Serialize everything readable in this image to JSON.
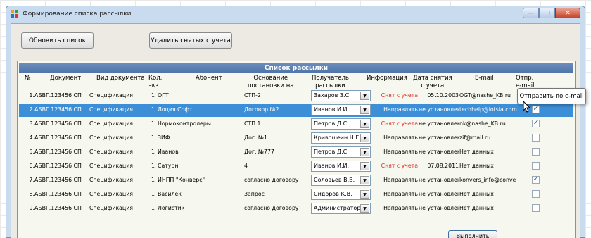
{
  "window": {
    "title": "Формирование списка рассылки",
    "min_icon": "minimize-icon",
    "max_icon": "maximize-icon",
    "close_icon": "close-icon"
  },
  "toolbar": {
    "refresh_label": "Обновить список",
    "delete_label": "Удалить снятых с учета"
  },
  "list": {
    "title": "Список рассылки",
    "columns": {
      "num": "№",
      "doc": "Документ",
      "type": "Вид документа",
      "qty1": "Кол.",
      "qty2": "экз",
      "abonent": "Абонент",
      "reason1": "Основание",
      "reason2": "постановки на",
      "recipient1": "Получатель",
      "recipient2": "рассылки",
      "info": "Информация",
      "date1": "Дата снятия",
      "date2": "с учета",
      "email": "E-mail",
      "send1": "Отпр.",
      "send2": "e-mail"
    },
    "rows": [
      {
        "num": "1.",
        "doc": "АБВГ.123456 СП",
        "type": "Спецификация",
        "qty": "1",
        "abonent": "ОГТ",
        "reason": "СТП-2",
        "recipient": "Захаров З.С.",
        "info": "Снят с учета",
        "info_red": true,
        "date": "05.10.2003",
        "email": "OGT@nashe_KB.ru",
        "checked": false
      },
      {
        "num": "2.",
        "doc": "АБВГ.123456 СП",
        "type": "Спецификация",
        "qty": "1",
        "abonent": "Лоция Софт",
        "reason": "Договор №2",
        "recipient": "Иванов И.И.",
        "info": "Направлять",
        "info_red": false,
        "date": "не установлена",
        "email": "techhelp@lotsia.com",
        "checked": true
      },
      {
        "num": "3.",
        "doc": "АБВГ.123456 СП",
        "type": "Спецификация",
        "qty": "1",
        "abonent": "Нормоконтролеры",
        "reason": "СТП 1",
        "recipient": "Петров Д.С.",
        "info": "Снят с учета",
        "info_red": true,
        "date": "не установлена",
        "email": "nk@nashe_KB.ru",
        "checked": true
      },
      {
        "num": "4.",
        "doc": "АБВГ.123456 СП",
        "type": "Спецификация",
        "qty": "1",
        "abonent": "ЗИФ",
        "reason": "Дог. №1",
        "recipient": "Кривошеин Н.Г.",
        "info": "Направлять",
        "info_red": false,
        "date": "не установлена",
        "email": "zif@mail.ru",
        "checked": false
      },
      {
        "num": "5.",
        "doc": "АБВГ.123456 СП",
        "type": "Спецификация",
        "qty": "1",
        "abonent": "Иванов",
        "reason": "Дог. №777",
        "recipient": "Петров Д.С.",
        "info": "Направлять",
        "info_red": false,
        "date": "не установлена",
        "email": "Нет данных",
        "checked": false
      },
      {
        "num": "6.",
        "doc": "АБВГ.123456 СП",
        "type": "Спецификация",
        "qty": "1",
        "abonent": "Сатурн",
        "reason": "4",
        "recipient": "Иванов И.И.",
        "info": "Снят с учета",
        "info_red": true,
        "date": "07.08.2011",
        "email": "Нет данных",
        "checked": false
      },
      {
        "num": "7.",
        "doc": "АБВГ.123456 СП",
        "type": "Спецификация",
        "qty": "1",
        "abonent": "ИНПП \"Конверс\"",
        "reason": "согласно договору",
        "recipient": "Соловьев В.В.",
        "info": "Направлять",
        "info_red": false,
        "date": "не установлена",
        "email": "konvers_info@conve",
        "checked": true
      },
      {
        "num": "8.",
        "doc": "АБВГ.123456 СП",
        "type": "Спецификация",
        "qty": "1",
        "abonent": "Василек",
        "reason": "Запрос",
        "recipient": "Сидоров К.В.",
        "info": "Направлять",
        "info_red": false,
        "date": "не установлена",
        "email": "Нет данных",
        "checked": false
      },
      {
        "num": "9.",
        "doc": "АБВГ.123456 СП",
        "type": "Спецификация",
        "qty": "1",
        "abonent": "Логистик",
        "reason": "согласно договору",
        "recipient": "Администратор",
        "info": "Направлять",
        "info_red": false,
        "date": "не установлена",
        "email": "Нет данных",
        "checked": false
      }
    ],
    "selected_row": 1
  },
  "tooltip": "Отправить по e-mail",
  "run_label": "Выполнить",
  "colors": {
    "selection": "#3c8fd6",
    "header": "#5a7fb4",
    "warning": "#e02b2b"
  }
}
